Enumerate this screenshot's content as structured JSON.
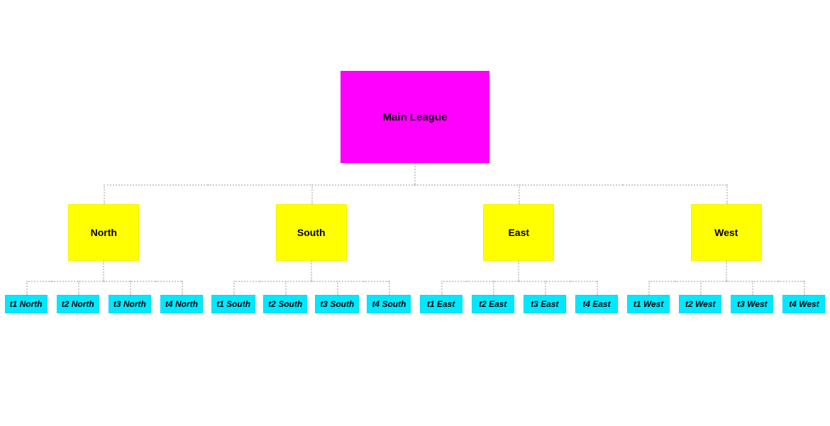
{
  "root": {
    "label": "Main League"
  },
  "divisions": [
    {
      "label": "North",
      "teams": [
        "t1 North",
        "t2 North",
        "t3 North",
        "t4 North"
      ]
    },
    {
      "label": "South",
      "teams": [
        "t1 South",
        "t2 South",
        "t3 South",
        "t4 South"
      ]
    },
    {
      "label": "East",
      "teams": [
        "t1 East",
        "t2 East",
        "t3 East",
        "t4 East"
      ]
    },
    {
      "label": "West",
      "teams": [
        "t1 West",
        "t2 West",
        "t3 West",
        "t4 West"
      ]
    }
  ],
  "colors": {
    "root": "#ff00ff",
    "division": "#ffff00",
    "team": "#00e8ff",
    "connector": "#cccccc"
  }
}
